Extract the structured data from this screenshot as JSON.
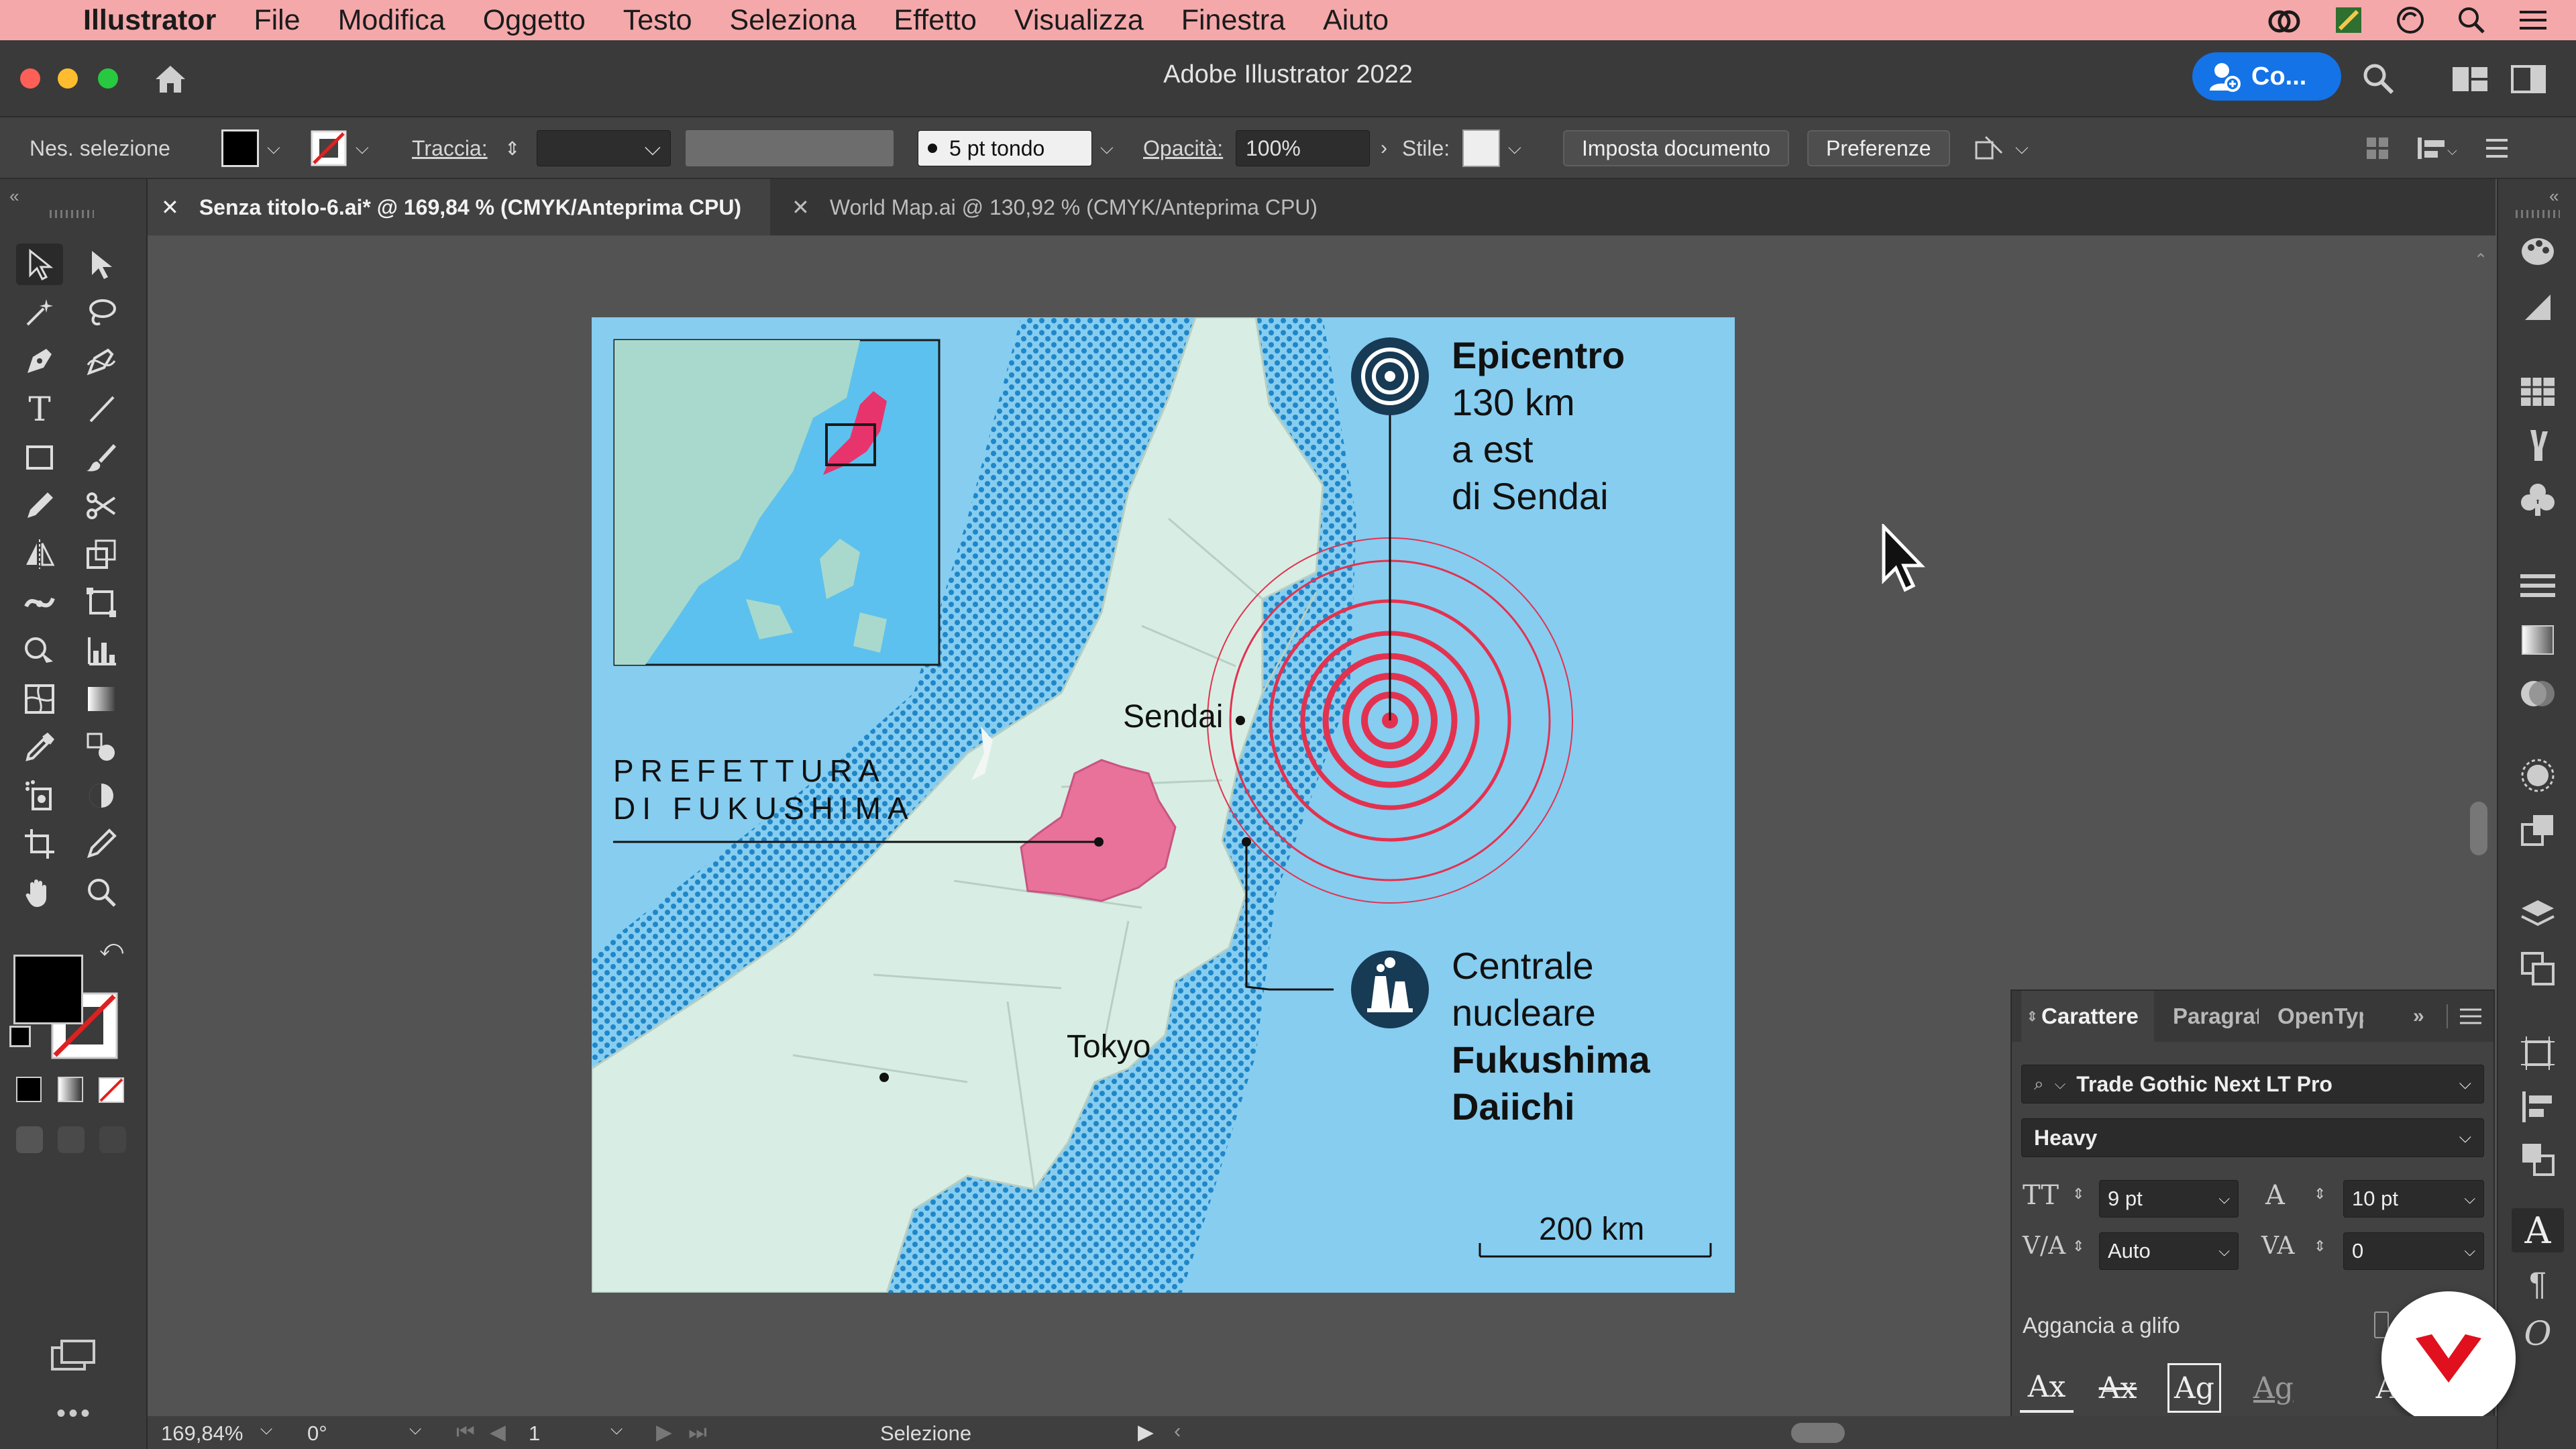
{
  "menubar": {
    "apple_icon": "apple-logo",
    "app_name": "Illustrator",
    "items": [
      "File",
      "Modifica",
      "Oggetto",
      "Testo",
      "Seleziona",
      "Effetto",
      "Visualizza",
      "Finestra",
      "Aiuto"
    ],
    "right_icons": [
      "creative-cloud-icon",
      "extension-icon",
      "sync-icon",
      "search-icon",
      "control-center-icon"
    ]
  },
  "titlebar": {
    "title": "Adobe Illustrator 2022",
    "share_label": "Co...",
    "icons": [
      "home-icon",
      "user-add-icon",
      "search-icon",
      "workspace-icon",
      "panel-toggle-icon"
    ]
  },
  "controlbar": {
    "selection_label": "Nes. selezione",
    "stroke_label": "Traccia:",
    "brush_value": "5 pt tondo",
    "opacity_label": "Opacità:",
    "opacity_value": "100%",
    "style_label": "Stile:",
    "setup_button": "Imposta documento",
    "prefs_button": "Preferenze"
  },
  "tabs": [
    {
      "label": "Senza titolo-6.ai* @ 169,84 % (CMYK/Anteprima CPU)",
      "active": true
    },
    {
      "label": "World Map.ai @ 130,92 % (CMYK/Anteprima CPU)",
      "active": false
    }
  ],
  "map": {
    "epicenter_title": "Epicentro",
    "epicenter_line1": "130 km",
    "epicenter_line2": "a est",
    "epicenter_line3": "di Sendai",
    "sendai": "Sendai",
    "tokyo": "Tokyo",
    "prefecture_line1": "PREFETTURA",
    "prefecture_line2": "DI FUKUSHIMA",
    "plant_line1": "Centrale",
    "plant_line2": "nucleare",
    "plant_line3": "Fukushima",
    "plant_line4": "Daiichi",
    "scale": "200 km",
    "colors": {
      "sea": "#86cdf0",
      "land": "#d8eee4",
      "fukushima": "#e8729a",
      "rings": "#e3324f",
      "icon": "#173a55"
    }
  },
  "character_panel": {
    "tabs": [
      "Carattere",
      "Paragraf",
      "OpenTyp"
    ],
    "font_family": "Trade Gothic Next LT Pro",
    "font_style": "Heavy",
    "font_size": "9 pt",
    "leading": "10 pt",
    "kerning": "Auto",
    "tracking": "0",
    "snap_label": "Aggancia a glifo",
    "glyph_buttons": [
      "Ax",
      "Ax",
      "Ag",
      "Ag",
      "A"
    ]
  },
  "statusbar": {
    "zoom": "169,84%",
    "rotation": "0°",
    "artboard": "1",
    "mode": "Selezione"
  }
}
